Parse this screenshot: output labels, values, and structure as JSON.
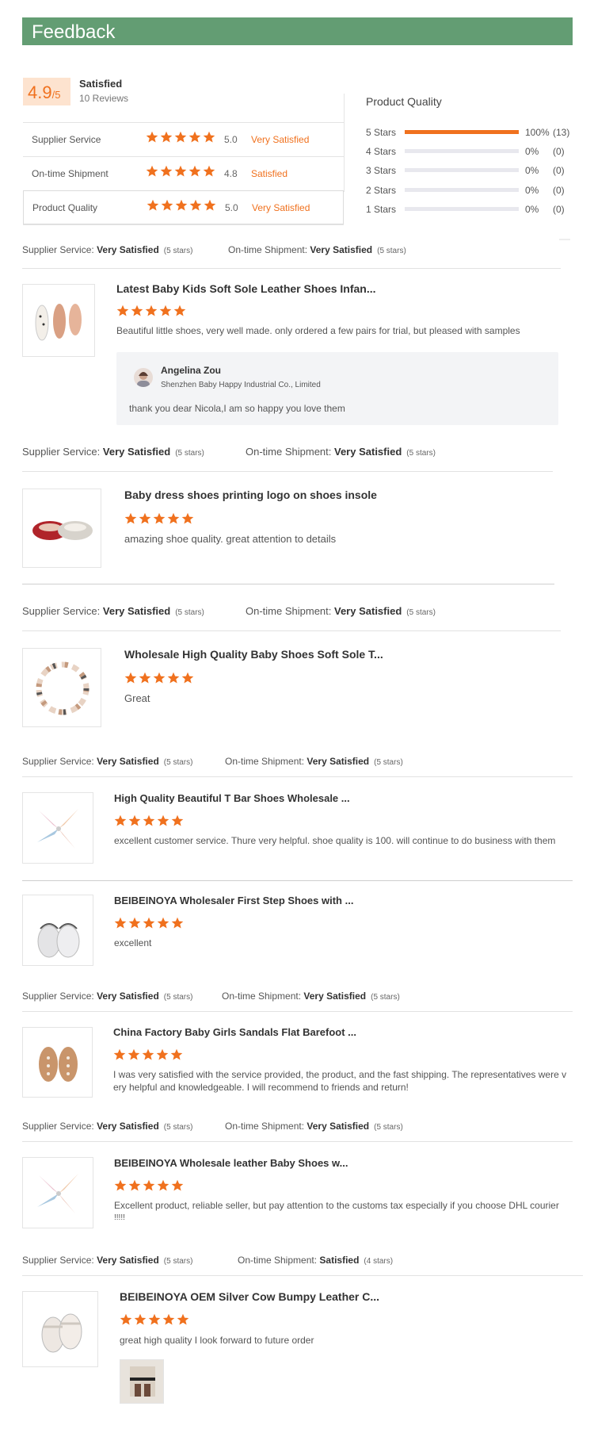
{
  "header": {
    "title": "Feedback"
  },
  "summary": {
    "score": "4.9",
    "score_suffix": "/5",
    "label": "Satisfied",
    "reviews": "10 Reviews",
    "rows": [
      {
        "label": "Supplier Service",
        "stars": 5,
        "value": "5.0",
        "text": "Very Satisfied"
      },
      {
        "label": "On-time Shipment",
        "stars": 5,
        "value": "4.8",
        "text": "Satisfied"
      },
      {
        "label": "Product Quality",
        "stars": 5,
        "value": "5.0",
        "text": "Very Satisfied"
      }
    ]
  },
  "product_quality": {
    "title": "Product Quality",
    "bars": [
      {
        "label": "5 Stars",
        "pct": "100%",
        "count": "(13)",
        "fill": 1.0
      },
      {
        "label": "4 Stars",
        "pct": "0%",
        "count": "(0)",
        "fill": 0
      },
      {
        "label": "3 Stars",
        "pct": "0%",
        "count": "(0)",
        "fill": 0
      },
      {
        "label": "2 Stars",
        "pct": "0%",
        "count": "(0)",
        "fill": 0
      },
      {
        "label": "1 Stars",
        "pct": "0%",
        "count": "(0)",
        "fill": 0
      }
    ]
  },
  "meta_labels": {
    "supplier": "Supplier Service:",
    "shipment": "On-time Shipment:"
  },
  "reviews": [
    {
      "supplier": "Very Satisfied",
      "supplier_stars": "(5 stars)",
      "shipment": "Very Satisfied",
      "shipment_stars": "(5 stars)",
      "title": "Latest Baby Kids Soft Sole Leather Shoes Infan...",
      "rating": 5,
      "text": "Beautiful little shoes, very well made. only ordered a few pairs for trial, but pleased with samples",
      "reply": {
        "name": "Angelina Zou",
        "company": "Shenzhen Baby Happy Industrial Co., Limited",
        "text": "thank you dear Nicola,I am so happy you love them"
      }
    },
    {
      "supplier": "Very Satisfied",
      "supplier_stars": "(5 stars)",
      "shipment": "Very Satisfied",
      "shipment_stars": "(5 stars)",
      "title": "Baby dress shoes printing logo on shoes insole",
      "rating": 5,
      "text": "amazing shoe quality. great attention to details"
    },
    {
      "supplier": "Very Satisfied",
      "supplier_stars": "(5 stars)",
      "shipment": "Very Satisfied",
      "shipment_stars": "(5 stars)",
      "title": "Wholesale High Quality Baby Shoes Soft Sole T...",
      "rating": 5,
      "text": "Great"
    },
    {
      "supplier": "Very Satisfied",
      "supplier_stars": "(5 stars)",
      "shipment": "Very Satisfied",
      "shipment_stars": "(5 stars)",
      "title": "High Quality Beautiful T Bar Shoes Wholesale ...",
      "rating": 5,
      "text": "excellent customer service. Thure very helpful. shoe quality is 100. will continue to do business with them"
    },
    {
      "title": "BEIBEINOYA Wholesaler First Step Shoes with ...",
      "rating": 5,
      "text": "excellent"
    },
    {
      "supplier": "Very Satisfied",
      "supplier_stars": "(5 stars)",
      "shipment": "Very Satisfied",
      "shipment_stars": "(5 stars)",
      "title": "China Factory Baby Girls Sandals Flat Barefoot ...",
      "rating": 5,
      "text_line1": "I was very satisfied with the service provided, the product, and the fast shipping. The representatives were v",
      "text_line2": "ery helpful and knowledgeable. I will recommend to friends and return!"
    },
    {
      "supplier": "Very Satisfied",
      "supplier_stars": "(5 stars)",
      "shipment": "Very Satisfied",
      "shipment_stars": "(5 stars)",
      "title": "BEIBEINOYA Wholesale leather Baby Shoes w...",
      "rating": 5,
      "text_line1": "Excellent product, reliable seller, but pay attention to the customs tax especially if you choose DHL courier",
      "text_line2": "!!!!!"
    },
    {
      "supplier": "Very Satisfied",
      "supplier_stars": "(5 stars)",
      "shipment": "Satisfied",
      "shipment_stars": "(4 stars)",
      "title": "BEIBEINOYA OEM Silver Cow Bumpy Leather C...",
      "rating": 5,
      "text": "great high quality I look forward to future order"
    }
  ],
  "colors": {
    "header": "#639d73",
    "accent": "#f0711e",
    "score_bg": "#fde3cf"
  }
}
